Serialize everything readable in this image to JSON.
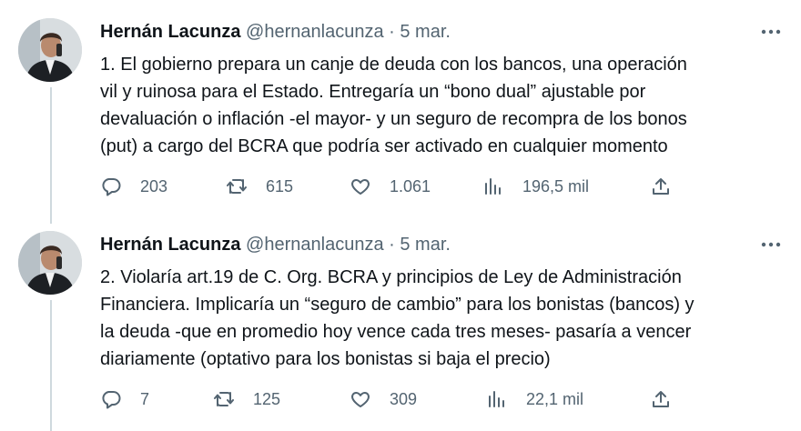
{
  "tweets": [
    {
      "author": {
        "name": "Hernán Lacunza",
        "handle": "@hernanlacunza",
        "separator": "·",
        "date": "5 mar."
      },
      "text_lines": [
        "1. El gobierno prepara un canje de deuda con los bancos, una operación",
        "vil y ruinosa para el Estado. Entregaría un “bono dual” ajustable por",
        "devaluación o inflación -el mayor- y un seguro de recompra de los bonos",
        "(put) a cargo del BCRA que podría ser activado en cualquier momento"
      ],
      "stats": {
        "replies": "203",
        "retweets": "615",
        "likes": "1.061",
        "views": "196,5 mil"
      },
      "icons": {
        "more": "more-dots-icon",
        "reply": "reply-icon",
        "retweet": "retweet-icon",
        "like": "heart-icon",
        "views": "views-icon",
        "share": "share-icon"
      }
    },
    {
      "author": {
        "name": "Hernán Lacunza",
        "handle": "@hernanlacunza",
        "separator": "·",
        "date": "5 mar."
      },
      "text_lines": [
        "2. Violaría art.19 de C. Org. BCRA y principios de Ley de Administración",
        "Financiera. Implicaría un “seguro de cambio” para los bonistas (bancos) y",
        "la deuda -que en promedio hoy vence cada tres meses- pasaría a vencer",
        "diariamente (optativo para los bonistas si baja el precio)"
      ],
      "stats": {
        "replies": "7",
        "retweets": "125",
        "likes": "309",
        "views": "22,1 mil"
      },
      "icons": {
        "more": "more-dots-icon",
        "reply": "reply-icon",
        "retweet": "retweet-icon",
        "like": "heart-icon",
        "views": "views-icon",
        "share": "share-icon"
      }
    }
  ],
  "colors": {
    "text": "#0f1419",
    "secondary": "#536471",
    "thread_line": "#cfd9de"
  }
}
